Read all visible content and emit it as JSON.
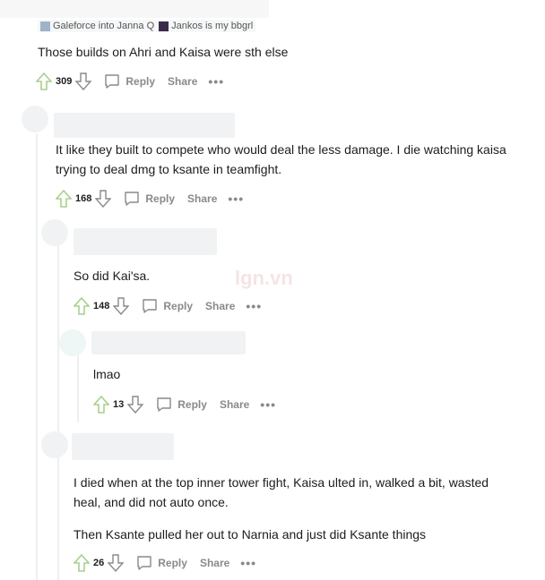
{
  "comments": [
    {
      "flair_left": "Galeforce into Janna Q",
      "flair_right": "Jankos is my bbgrl",
      "text": "Those builds on Ahri and Kaisa were sth else",
      "score": "309",
      "reply_label": "Reply",
      "share_label": "Share",
      "more_label": "•••"
    },
    {
      "text_line1": "It like they built to compete who would deal the less damage. I die watching kaisa",
      "text_line2": "trying to deal dmg to ksante in teamfight.",
      "score": "168",
      "reply_label": "Reply",
      "share_label": "Share",
      "more_label": "•••"
    },
    {
      "text": "So did Kai'sa.",
      "score": "148",
      "reply_label": "Reply",
      "share_label": "Share",
      "more_label": "•••"
    },
    {
      "text": "lmao",
      "score": "13",
      "reply_label": "Reply",
      "share_label": "Share",
      "more_label": "•••"
    },
    {
      "para1_line1": "I died when at the top inner tower fight, Kaisa ulted in, walked a bit, wasted",
      "para1_line2": "heal, and did not auto once.",
      "para2": "Then Ksante pulled her out to Narnia and just did Ksante things",
      "score": "26",
      "reply_label": "Reply",
      "share_label": "Share",
      "more_label": "•••"
    }
  ],
  "watermark": "lgn.vn",
  "colors": {
    "upvote": "#a8d08d",
    "icon_gray": "#878a8c",
    "thread_line": "#edeff1"
  }
}
